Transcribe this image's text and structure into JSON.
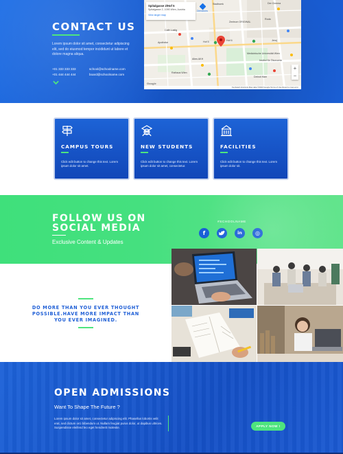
{
  "contact": {
    "title": "CONTACT US",
    "text": "Lorem ipsum dolor sit amet, consectetur adipiscing elit, sed do eiusmod tempor incididunt ut labore et dolore magna aliqua.",
    "phone1": "+01 333 333 333",
    "phone2": "+01 444 444 444",
    "email1": "school@schoolname.com",
    "email2": "board@schoolname.com",
    "accent": "#4ee57e",
    "chevron_icon": "chevron-down-icon"
  },
  "map": {
    "place_title": "Spitalgasse 2/Hof 5",
    "place_address": "Spitalgasse 2, 1090 Wien, Austria",
    "view_larger": "View larger map",
    "directions": "Directions",
    "labels": {
      "cafe": "Café Lustig",
      "stadtwerk": "Stadtwerk",
      "zentrum": "Zentrum ORIGINAL",
      "hof5": "Hof 5",
      "hof6": "Hof 6",
      "roda": "Roda",
      "jeroj": "Jeroj",
      "altes": "Altes AKH",
      "medwien": "Medizinische Universität Wien",
      "inst": "Institut für Ökonomie",
      "rathaus": "Rathaus Wien",
      "dp": "Detroit Ham",
      "cinema": "Der Cinema",
      "apotheke": "Apotheke"
    },
    "google": "Google",
    "footer": "Keyboard shortcuts   Map data ©2023 Google   Terms of Use   Report a map error",
    "zoom_in": "+",
    "zoom_out": "−"
  },
  "features": [
    {
      "title": "CAMPUS TOURS",
      "text": "Click edit button to change this text. Lorem ipsum dolor sit amet.",
      "icon": "signpost-icon"
    },
    {
      "title": "NEW STUDENTS",
      "text": "Click edit button to change this text. Lorem ipsum dolor sit amet, consectetur.",
      "icon": "student-icon"
    },
    {
      "title": "FACILITIES",
      "text": "Click edit button to change this text. Lorem ipsum dolor sit.",
      "icon": "building-icon"
    }
  ],
  "social": {
    "title_line1": "FOLLOW US ON",
    "title_line2": "SOCIAL MEDIA",
    "subtitle": "Exclusive Content & Updates",
    "hashtag": "#SCHOOLNAME",
    "buttons": [
      {
        "glyph": "f",
        "icon": "facebook-icon"
      },
      {
        "glyph": "t",
        "icon": "twitter-icon"
      },
      {
        "glyph": "in",
        "icon": "linkedin-icon"
      },
      {
        "glyph": "◎",
        "icon": "instagram-icon"
      }
    ]
  },
  "promo": {
    "text": "DO MORE THAN YOU EVER THOUGHT POSSIBLE.HAVE MORE IMPACT THAN YOU EVER IMAGINED."
  },
  "admissions": {
    "title": "OPEN ADMISSIONS",
    "subtitle": "Want To Shape The Future ?",
    "text": "Lorem ipsum dolor sit amet, consectetur adipiscing elit. Phasellus lobortis velit erat, sed dictum orci bibendum ut. Nullam feugiat purus dolor, ut dapibus ultrices. Suspendisse eleifend leo eget hendrerit molestie.",
    "button": "APPLY NOW !"
  }
}
